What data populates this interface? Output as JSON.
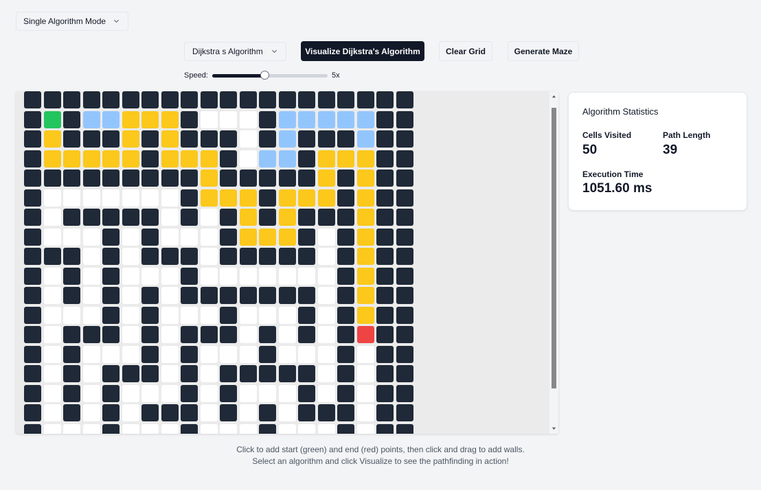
{
  "controls": {
    "mode_select": "Single Algorithm Mode",
    "algorithm_select": "Dijkstra s Algorithm",
    "visualize_label": "Visualize Dijkstra's Algorithm",
    "clear_label": "Clear Grid",
    "maze_label": "Generate Maze",
    "speed_label": "Speed:",
    "speed_value": "5x",
    "speed_level": 0.45
  },
  "stats": {
    "title": "Algorithm Statistics",
    "cells_visited_label": "Cells Visited",
    "cells_visited_value": "50",
    "path_length_label": "Path Length",
    "path_length_value": "39",
    "execution_time_label": "Execution Time",
    "execution_time_value": "1051.60 ms"
  },
  "help": {
    "line1": "Click to add start (green) and end (red) points, then click and drag to add walls.",
    "line2": "Select an algorithm and click Visualize to see the pathfinding in action!"
  },
  "colors": {
    "wall": "#1f2937",
    "empty": "#ffffff",
    "visited": "#93c5fd",
    "path": "#fbc81b",
    "start": "#22c55e",
    "end": "#ef4444",
    "primary_button": "#111827"
  },
  "grid_legend": {
    "#": "wall",
    ".": "empty",
    "V": "visited",
    "P": "path",
    "S": "start",
    "E": "end"
  },
  "grid_rows": [
    "####################",
    "#S#VVPPP#...#VVVVV##",
    "#P###P#P###.#V###V##",
    "#PPPPP#PPP#.VV#PPP##",
    "#########P#####P#P##",
    "#.......#PPP#PPP#P##",
    "#.#####.#.#P#P###P##",
    "#...#.#...#PPP#.#P##",
    "###.#.###.#####.#P##",
    "#.#.#...#.......#P##",
    "#.#.#.#.#######.#P##",
    "#...#.#...#...#.#P##",
    "#.###.#.###.#.#.#E##",
    "#.#...#.#...#...#.##",
    "#.#.###.#.#####.#.##",
    "#.#.#...#.#...#.#.##",
    "#.#.#.###.#.#.###.##",
    "#...#...#...#...#.##"
  ]
}
